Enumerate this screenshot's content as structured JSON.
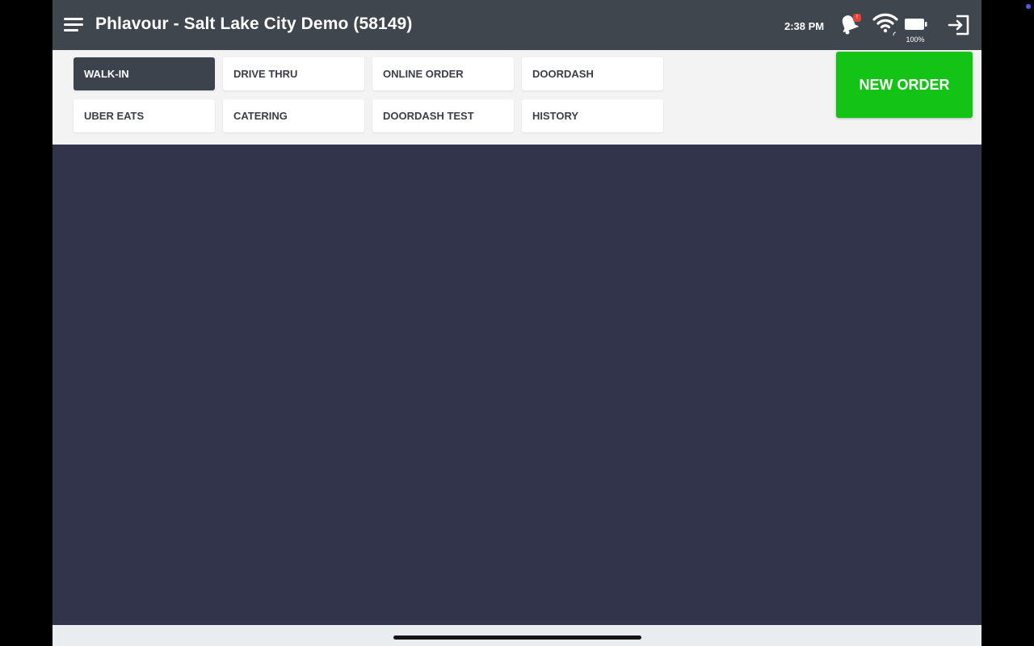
{
  "header": {
    "title": "Phlavour - Salt Lake City Demo (58149)",
    "time": "2:38 PM",
    "notification_badge": "!",
    "battery_percent": "100%"
  },
  "tabs": [
    {
      "label": "WALK-IN",
      "active": true
    },
    {
      "label": "DRIVE THRU",
      "active": false
    },
    {
      "label": "ONLINE ORDER",
      "active": false
    },
    {
      "label": "DOORDASH",
      "active": false
    },
    {
      "label": "UBER EATS",
      "active": false
    },
    {
      "label": "CATERING",
      "active": false
    },
    {
      "label": "DOORDASH TEST",
      "active": false
    },
    {
      "label": "HISTORY",
      "active": false
    }
  ],
  "new_order_label": "NEW ORDER",
  "icons": {
    "menu": "hamburger-menu-icon",
    "notification": "bell-icon",
    "wifi": "wifi-icon",
    "battery": "battery-icon",
    "logout": "logout-icon"
  },
  "colors": {
    "header_bg": "#40464d",
    "content_bg": "#31344a",
    "tab_area_bg": "#f3f3f3",
    "active_tab_bg": "#3d434c",
    "new_order_bg": "#13c417",
    "badge": "#e0433a"
  }
}
